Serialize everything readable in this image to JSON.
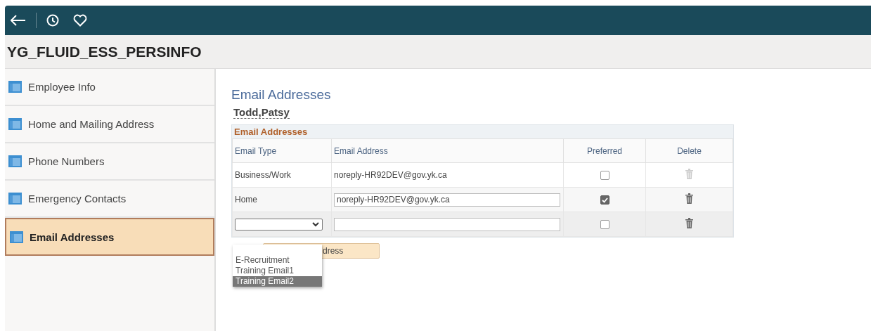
{
  "page_title": "YG_FLUID_ESS_PERSINFO",
  "sidebar": {
    "items": [
      {
        "label": "Employee Info",
        "selected": false
      },
      {
        "label": "Home and Mailing Address",
        "selected": false
      },
      {
        "label": "Phone Numbers",
        "selected": false
      },
      {
        "label": "Emergency Contacts",
        "selected": false
      },
      {
        "label": "Email Addresses",
        "selected": true
      }
    ]
  },
  "heading": "Email Addresses",
  "employee_name": "Todd,Patsy",
  "grid": {
    "title": "Email Addresses",
    "columns": [
      "Email Type",
      "Email Address",
      "Preferred",
      "Delete"
    ],
    "rows": [
      {
        "kind": "readonly",
        "type": "Business/Work",
        "address": "noreply-HR92DEV@gov.yk.ca",
        "preferred": false,
        "delete_disabled": true
      },
      {
        "kind": "editable",
        "type": "Home",
        "address": "noreply-HR92DEV@gov.yk.ca",
        "preferred": true,
        "delete_disabled": false
      },
      {
        "kind": "new",
        "preferred": false,
        "delete_disabled": false
      }
    ]
  },
  "add_button": "dress",
  "dropdown": {
    "options": [
      {
        "label": "E-Recruitment",
        "selected": false
      },
      {
        "label": "Training Email1",
        "selected": false
      },
      {
        "label": "Training Email2",
        "selected": true
      }
    ]
  }
}
